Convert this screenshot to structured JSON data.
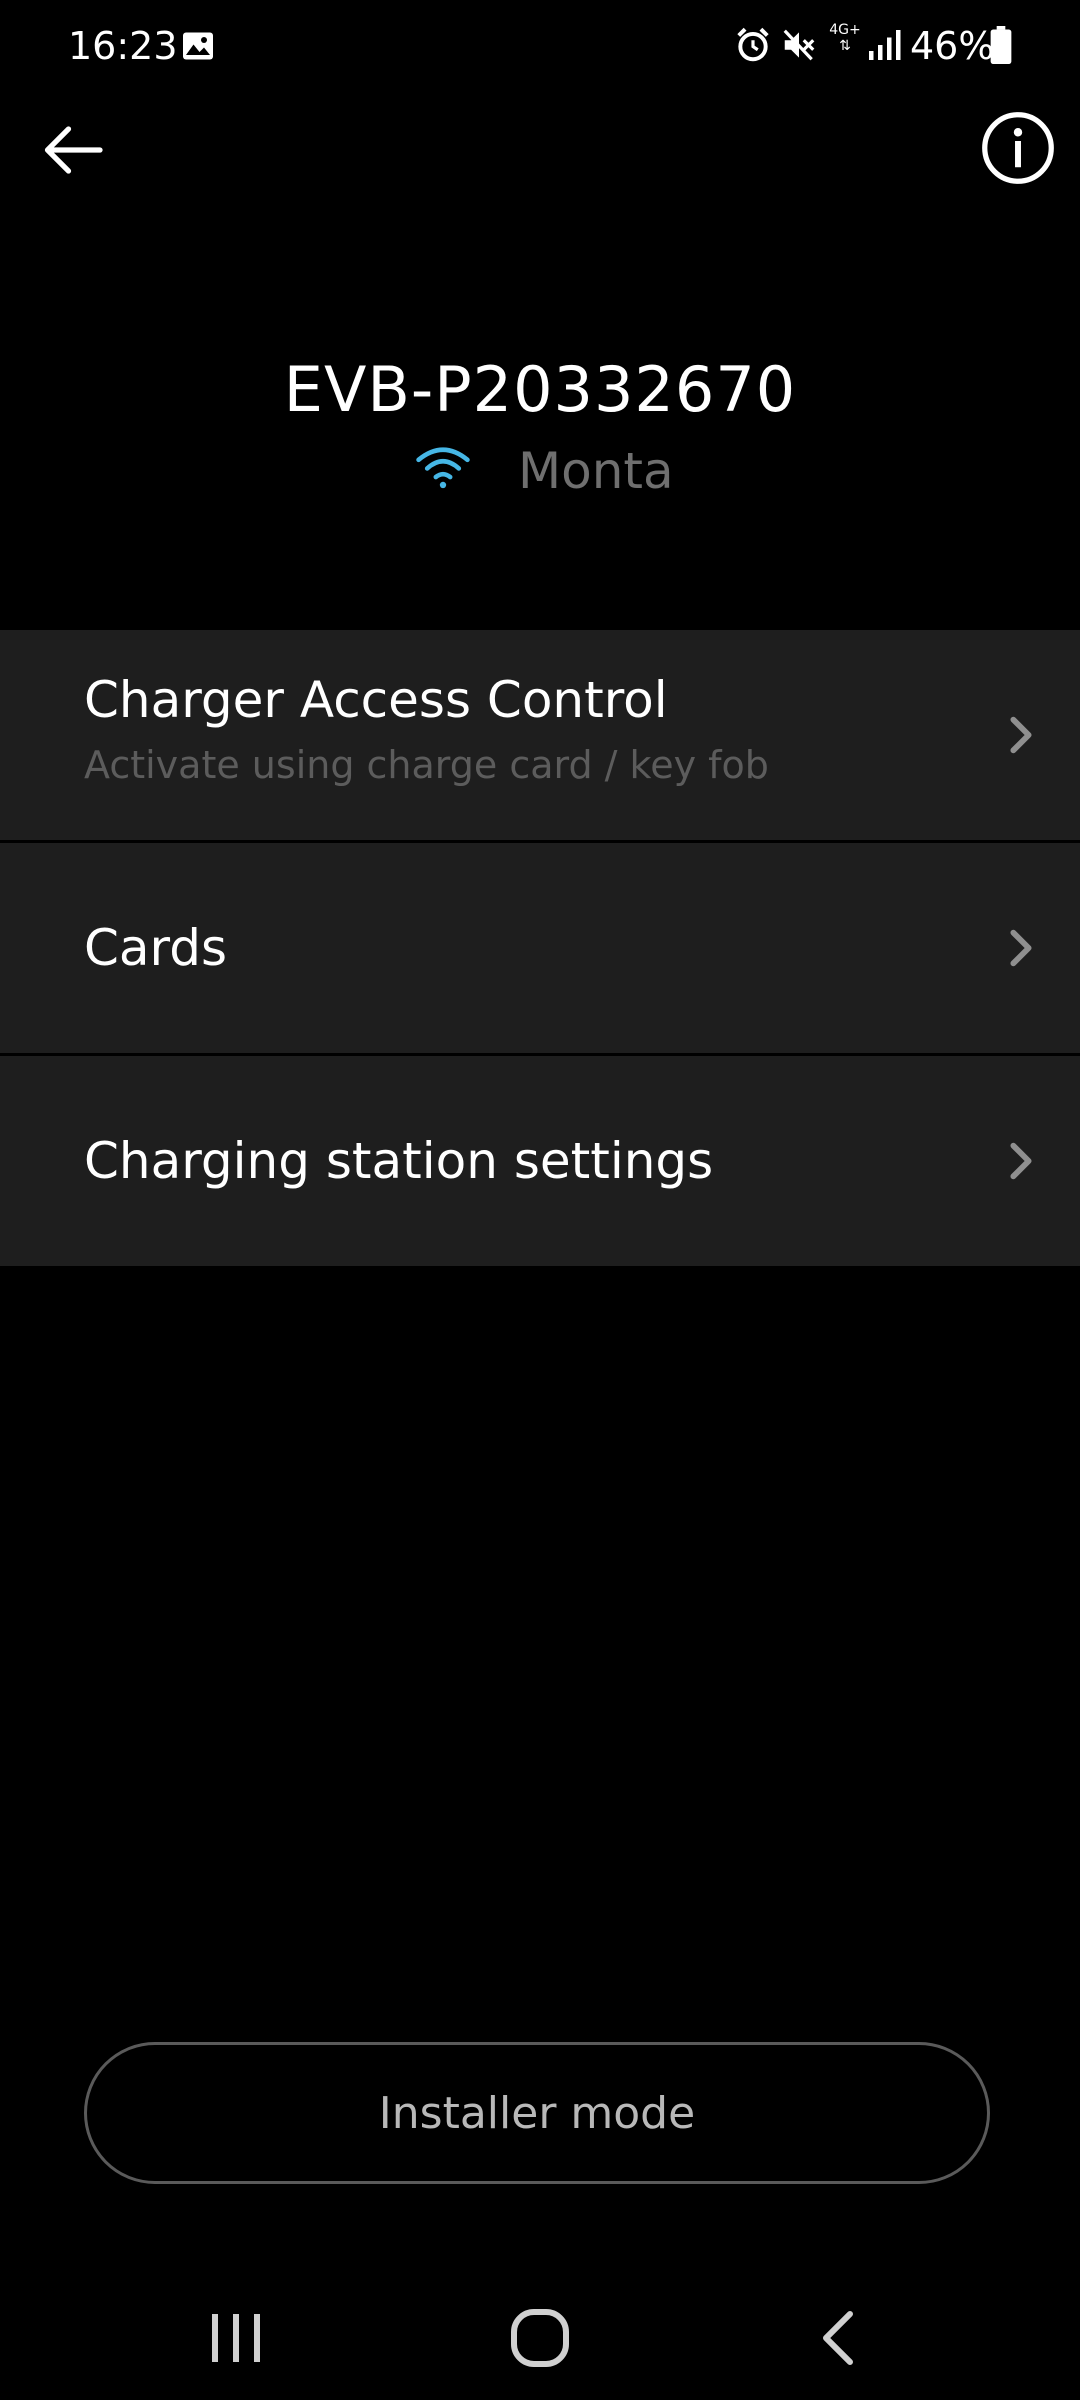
{
  "status_bar": {
    "time": "16:23",
    "network_type": "4G+",
    "battery_percent": "46%",
    "icons": [
      "gallery-icon",
      "alarm-icon",
      "mute-icon",
      "signal-icon",
      "battery-icon"
    ]
  },
  "app_bar": {
    "back_icon": "back-arrow-icon",
    "info_icon": "info-icon"
  },
  "header": {
    "charger_id": "EVB-P20332670",
    "network_name": "Monta",
    "wifi_color": "#46b7e6"
  },
  "menu": {
    "items": [
      {
        "title": "Charger Access Control",
        "subtitle": "Activate using charge card / key fob"
      },
      {
        "title": "Cards"
      },
      {
        "title": "Charging station settings"
      }
    ]
  },
  "installer_button": {
    "label": "Installer mode"
  },
  "nav_bar": {
    "icons": [
      "recents-icon",
      "home-icon",
      "nav-back-icon"
    ]
  }
}
